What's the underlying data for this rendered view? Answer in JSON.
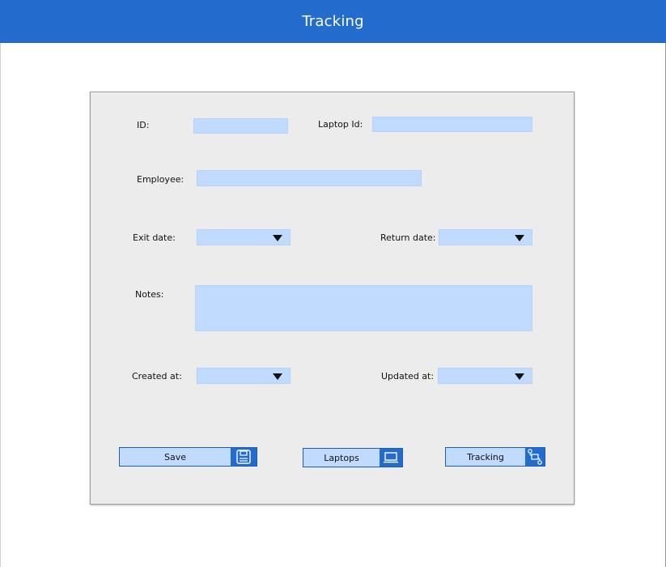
{
  "header": {
    "title": "Tracking"
  },
  "form": {
    "id_label": "ID:",
    "id_value": "",
    "laptop_id_label": "Laptop Id:",
    "laptop_id_value": "",
    "employee_label": "Employee:",
    "employee_value": "",
    "exit_date_label": "Exit date:",
    "exit_date_value": "",
    "return_date_label": "Return date:",
    "return_date_value": "",
    "notes_label": "Notes:",
    "notes_value": "",
    "created_at_label": "Created at:",
    "created_at_value": "",
    "updated_at_label": "Updated at:",
    "updated_at_value": ""
  },
  "buttons": {
    "save": {
      "label": "Save",
      "icon": "floppy-disk-icon"
    },
    "laptops": {
      "label": "Laptops",
      "icon": "laptop-icon"
    },
    "tracking": {
      "label": "Tracking",
      "icon": "route-map-icon"
    }
  },
  "colors": {
    "header": "#236bcc",
    "field": "#c1dbff",
    "panel": "#ececec",
    "icon_bg": "#236bcc"
  }
}
